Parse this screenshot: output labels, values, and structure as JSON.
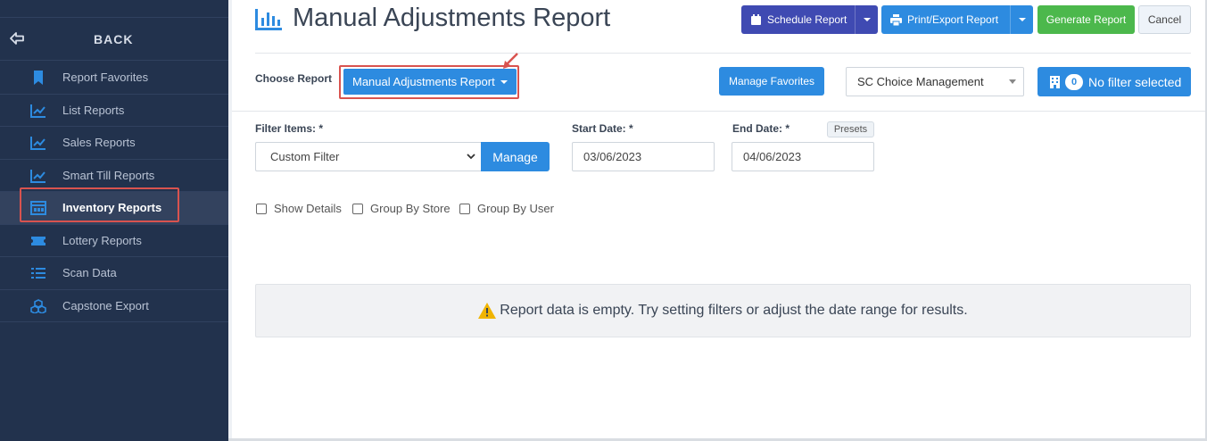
{
  "sidebar": {
    "back_label": "BACK",
    "items": [
      {
        "label": "Report Favorites",
        "icon": "bookmark-icon"
      },
      {
        "label": "List Reports",
        "icon": "trend-chart-icon"
      },
      {
        "label": "Sales Reports",
        "icon": "trend-chart-icon"
      },
      {
        "label": "Smart Till Reports",
        "icon": "trend-chart-icon"
      },
      {
        "label": "Inventory Reports",
        "icon": "inventory-icon",
        "active": true
      },
      {
        "label": "Lottery Reports",
        "icon": "ticket-icon"
      },
      {
        "label": "Scan Data",
        "icon": "list-icon"
      },
      {
        "label": "Capstone Export",
        "icon": "cubes-icon"
      }
    ]
  },
  "header": {
    "title": "Manual Adjustments Report",
    "schedule_label": "Schedule Report",
    "print_label": "Print/Export Report",
    "generate_label": "Generate Report",
    "cancel_label": "Cancel"
  },
  "report_row": {
    "choose_label": "Choose Report",
    "selected_report": "Manual Adjustments Report",
    "manage_favorites_label": "Manage Favorites",
    "store_select": "SC Choice Management",
    "filter_count": "0",
    "filter_label": "No filter selected"
  },
  "filters": {
    "filter_items_label": "Filter Items: *",
    "filter_items_value": "Custom Filter",
    "manage_label": "Manage",
    "start_date_label": "Start Date: *",
    "start_date_value": "03/06/2023",
    "end_date_label": "End Date: *",
    "end_date_value": "04/06/2023",
    "presets_label": "Presets"
  },
  "options": {
    "show_details": "Show Details",
    "group_by_store": "Group By Store",
    "group_by_user": "Group By User"
  },
  "empty_message": "Report data is empty. Try setting filters or adjust the date range for results.",
  "colors": {
    "sidebar_bg": "#22324d",
    "primary": "#2d8be0",
    "schedule": "#3f4ab2",
    "generate": "#4cb84c",
    "highlight": "#d9534f",
    "warning": "#f0b400"
  }
}
